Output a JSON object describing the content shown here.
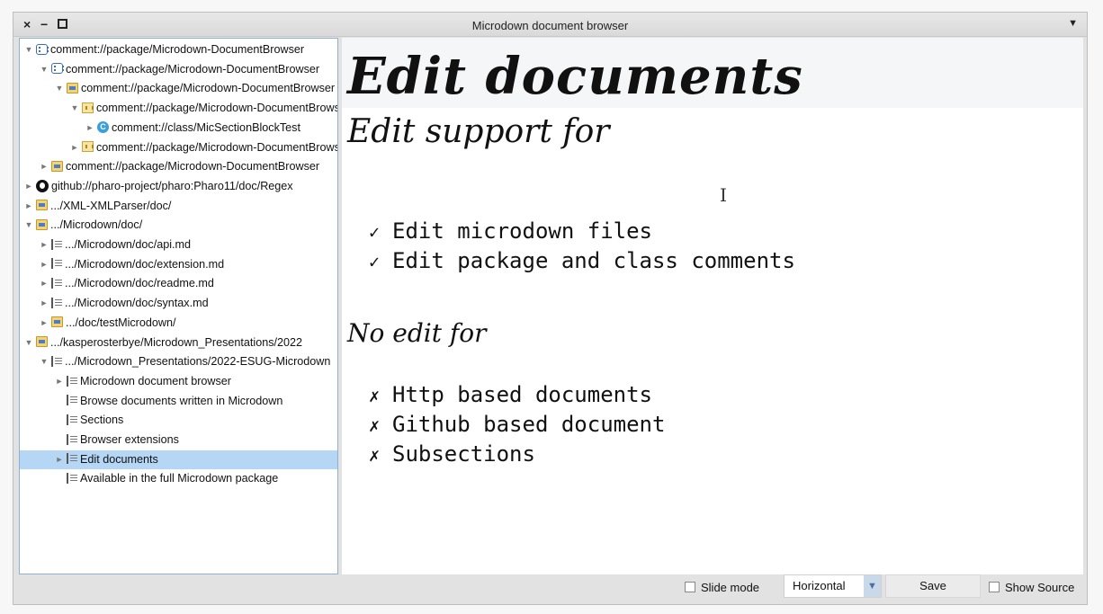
{
  "window": {
    "title": "Microdown document browser",
    "controls": {
      "close": "×",
      "minimize": "−"
    }
  },
  "tree": {
    "items": [
      {
        "indent": 0,
        "toggle": "▼",
        "icon": "pkg",
        "label": "comment://package/Microdown-DocumentBrowser"
      },
      {
        "indent": 1,
        "toggle": "▼",
        "icon": "pkg",
        "label": "comment://package/Microdown-DocumentBrowser"
      },
      {
        "indent": 2,
        "toggle": "▼",
        "icon": "folder",
        "label": "comment://package/Microdown-DocumentBrowser"
      },
      {
        "indent": 3,
        "toggle": "▼",
        "icon": "tag",
        "label": "comment://package/Microdown-DocumentBrowser"
      },
      {
        "indent": 4,
        "toggle": "►",
        "icon": "cls",
        "label": "comment://class/MicSectionBlockTest"
      },
      {
        "indent": 3,
        "toggle": "►",
        "icon": "tag",
        "label": "comment://package/Microdown-DocumentBrowser"
      },
      {
        "indent": 1,
        "toggle": "►",
        "icon": "folder",
        "label": "comment://package/Microdown-DocumentBrowser"
      },
      {
        "indent": 0,
        "toggle": "►",
        "icon": "gh",
        "label": "github://pharo-project/pharo:Pharo11/doc/Regex"
      },
      {
        "indent": 0,
        "toggle": "►",
        "icon": "folder",
        "label": ".../XML-XMLParser/doc/"
      },
      {
        "indent": 0,
        "toggle": "▼",
        "icon": "folder",
        "label": ".../Microdown/doc/"
      },
      {
        "indent": 1,
        "toggle": "►",
        "icon": "md",
        "label": ".../Microdown/doc/api.md"
      },
      {
        "indent": 1,
        "toggle": "►",
        "icon": "md",
        "label": ".../Microdown/doc/extension.md"
      },
      {
        "indent": 1,
        "toggle": "►",
        "icon": "md",
        "label": ".../Microdown/doc/readme.md"
      },
      {
        "indent": 1,
        "toggle": "►",
        "icon": "md",
        "label": ".../Microdown/doc/syntax.md"
      },
      {
        "indent": 1,
        "toggle": "►",
        "icon": "folder",
        "label": ".../doc/testMicrodown/"
      },
      {
        "indent": 0,
        "toggle": "▼",
        "icon": "folder",
        "label": ".../kasperosterbye/Microdown_Presentations/2022"
      },
      {
        "indent": 1,
        "toggle": "▼",
        "icon": "md",
        "label": ".../Microdown_Presentations/2022-ESUG-Microdown"
      },
      {
        "indent": 2,
        "toggle": "►",
        "icon": "md",
        "label": "Microdown document browser"
      },
      {
        "indent": 2,
        "toggle": "",
        "icon": "md",
        "label": "Browse documents written in Microdown"
      },
      {
        "indent": 2,
        "toggle": "",
        "icon": "md",
        "label": "Sections"
      },
      {
        "indent": 2,
        "toggle": "",
        "icon": "md",
        "label": "Browser extensions"
      },
      {
        "indent": 2,
        "toggle": "►",
        "icon": "md",
        "label": "Edit documents",
        "selected": true
      },
      {
        "indent": 2,
        "toggle": "",
        "icon": "md",
        "label": "Available in the full Microdown package"
      }
    ]
  },
  "document": {
    "title": "Edit documents",
    "section1": "Edit support for",
    "section1_items": [
      "Edit microdown files",
      "Edit package and class comments"
    ],
    "section1_mark": "✓",
    "section2": "No edit for",
    "section2_items": [
      "Http based documents",
      "Github based document",
      "Subsections"
    ],
    "section2_mark": "✗",
    "text_cursor": "I"
  },
  "toolbar": {
    "slide_mode_label": "Slide mode",
    "orientation_value": "Horizontal",
    "save_label": "Save",
    "show_source_label": "Show Source"
  },
  "colors": {
    "selection": "#b6d6f5",
    "tree_border": "#8fb1d1"
  }
}
